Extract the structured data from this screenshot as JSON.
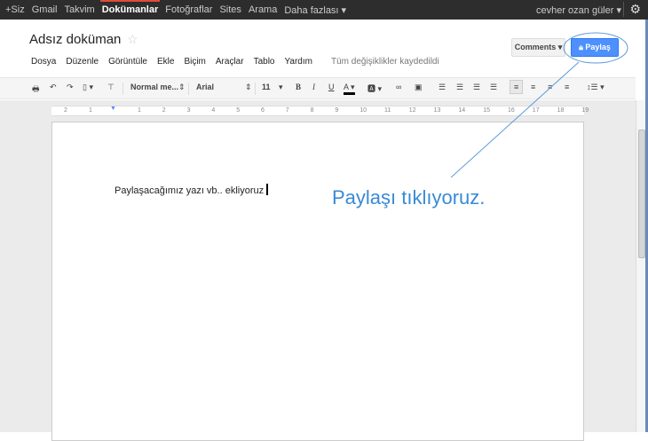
{
  "topbar": {
    "links": [
      "+Siz",
      "Gmail",
      "Takvim",
      "Dokümanlar",
      "Fotoğraflar",
      "Sites",
      "Arama",
      "Daha fazlası ▾"
    ],
    "active": "Dokümanlar",
    "user": "cevher ozan güler ▾"
  },
  "document": {
    "title": "Adsız doküman",
    "saved_status": "Tüm değişiklikler kaydedildi",
    "body_text": "Paylaşacağımız yazı vb..  ekliyoruz"
  },
  "menu": [
    "Dosya",
    "Düzenle",
    "Görüntüle",
    "Ekle",
    "Biçim",
    "Araçlar",
    "Tablo",
    "Yardım"
  ],
  "buttons": {
    "comments": "Comments ▾",
    "share": "Paylaş"
  },
  "toolbar": {
    "style": "Normal me...",
    "font": "Arial",
    "size": "11"
  },
  "ruler": [
    "2",
    "1",
    "1",
    "2",
    "3",
    "4",
    "5",
    "6",
    "7",
    "8",
    "9",
    "10",
    "11",
    "12",
    "13",
    "14",
    "15",
    "16",
    "17",
    "18",
    "19"
  ],
  "annotation": {
    "text": "Paylaşı tıklıyoruz.",
    "color": "#3a8ad5"
  },
  "colors": {
    "share_button": "#4d90fe",
    "topbar": "#2d2d2d"
  }
}
